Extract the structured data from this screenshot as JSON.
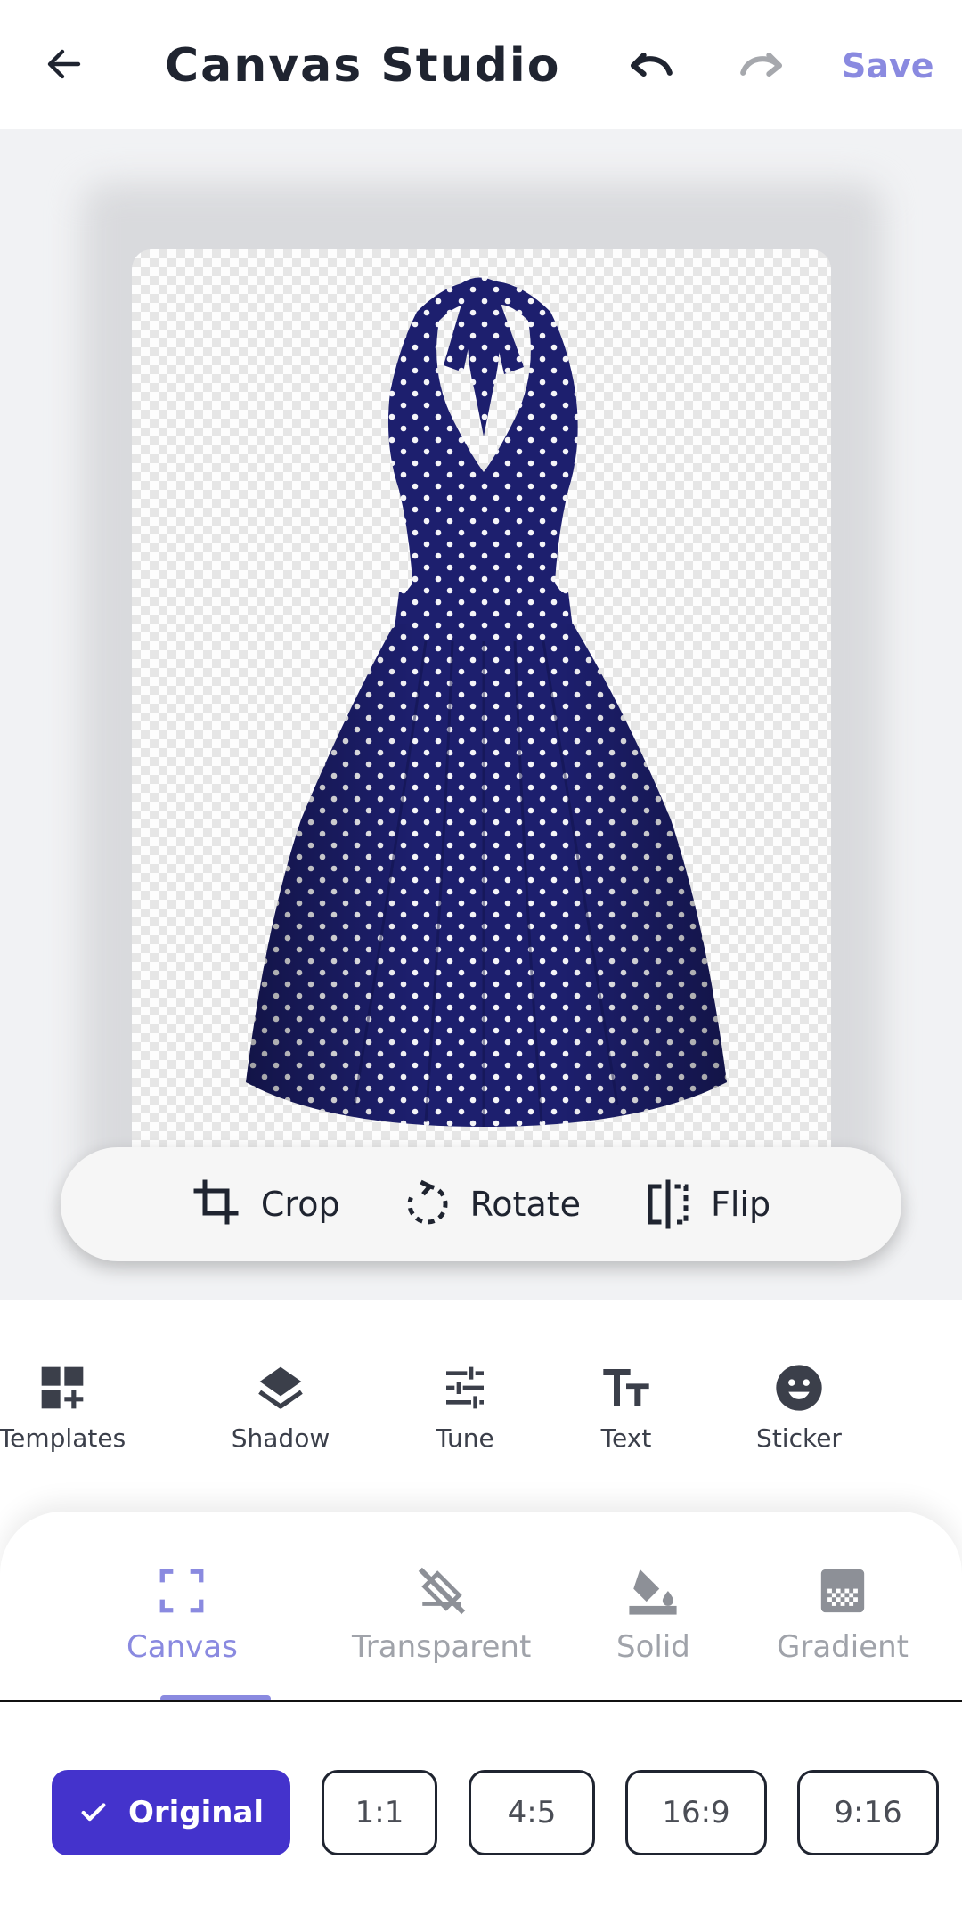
{
  "header": {
    "title": "Canvas Studio",
    "save_label": "Save",
    "icons": {
      "back": "arrow-left-icon",
      "undo": "undo-icon",
      "redo": "redo-icon"
    }
  },
  "canvas": {
    "image": "polka-dot halter dress (navy with white dots) on transparent background",
    "tools": [
      {
        "label": "Crop",
        "icon": "crop-icon"
      },
      {
        "label": "Rotate",
        "icon": "rotate-icon"
      },
      {
        "label": "Flip",
        "icon": "flip-icon"
      }
    ]
  },
  "features": [
    {
      "label": "Templates",
      "icon": "templates-icon"
    },
    {
      "label": "Shadow",
      "icon": "layers-icon"
    },
    {
      "label": "Tune",
      "icon": "sliders-icon"
    },
    {
      "label": "Text",
      "icon": "text-icon"
    },
    {
      "label": "Sticker",
      "icon": "smiley-icon"
    }
  ],
  "tabs": [
    {
      "label": "Canvas",
      "icon": "canvas-frame-icon",
      "active": true
    },
    {
      "label": "Transparent",
      "icon": "transparent-icon",
      "active": false
    },
    {
      "label": "Solid",
      "icon": "paint-bucket-icon",
      "active": false
    },
    {
      "label": "Gradient",
      "icon": "gradient-icon",
      "active": false
    }
  ],
  "ratios": [
    {
      "label": "Original",
      "selected": true
    },
    {
      "label": "1:1",
      "selected": false
    },
    {
      "label": "4:5",
      "selected": false
    },
    {
      "label": "16:9",
      "selected": false
    },
    {
      "label": "9:16",
      "selected": false
    }
  ],
  "colors": {
    "accent": "#8a8ae0",
    "selected_button": "#4433cc",
    "dress": "#1d1f6e"
  }
}
